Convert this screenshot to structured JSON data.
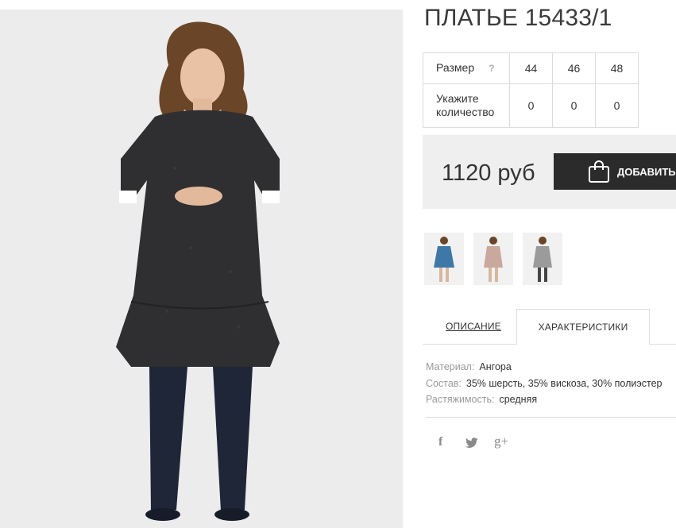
{
  "product": {
    "title": "ПЛАТЬЕ 15433/1",
    "image_alt": "dress-model-photo"
  },
  "sizes_table": {
    "size_label": "Размер",
    "help_symbol": "?",
    "quantity_label_line1": "Укажите",
    "quantity_label_line2": "количество",
    "sizes": [
      "44",
      "46",
      "48"
    ],
    "quantities": [
      "0",
      "0",
      "0"
    ]
  },
  "purchase": {
    "price": "1120 руб",
    "add_button_label": "ДОБАВИТЬ В КОРЗИНУ",
    "add_button_icon": "shopping-bag-icon"
  },
  "thumbnails": [
    {
      "name": "thumb-blue-dress",
      "color": "#3e78a6"
    },
    {
      "name": "thumb-pink-dress",
      "color": "#c9a89d"
    },
    {
      "name": "thumb-grey-dress",
      "color": "#9b9b9b"
    }
  ],
  "tabs": {
    "description": "ОПИСАНИЕ",
    "characteristics": "ХАРАКТЕРИСТИКИ",
    "active": "characteristics"
  },
  "specs": [
    {
      "key": "Материал:",
      "value": "Ангора"
    },
    {
      "key": "Состав:",
      "value": "35% шерсть, 35% вискоза, 30% полиэстер"
    },
    {
      "key": "Растяжимость:",
      "value": "средняя"
    }
  ],
  "social": {
    "facebook": "f",
    "twitter_icon": "twitter-bird-icon",
    "google": "g+"
  },
  "colors": {
    "button_bg": "#2b2b2b",
    "price_box_bg": "#efefef",
    "photo_bg": "#ececec"
  }
}
